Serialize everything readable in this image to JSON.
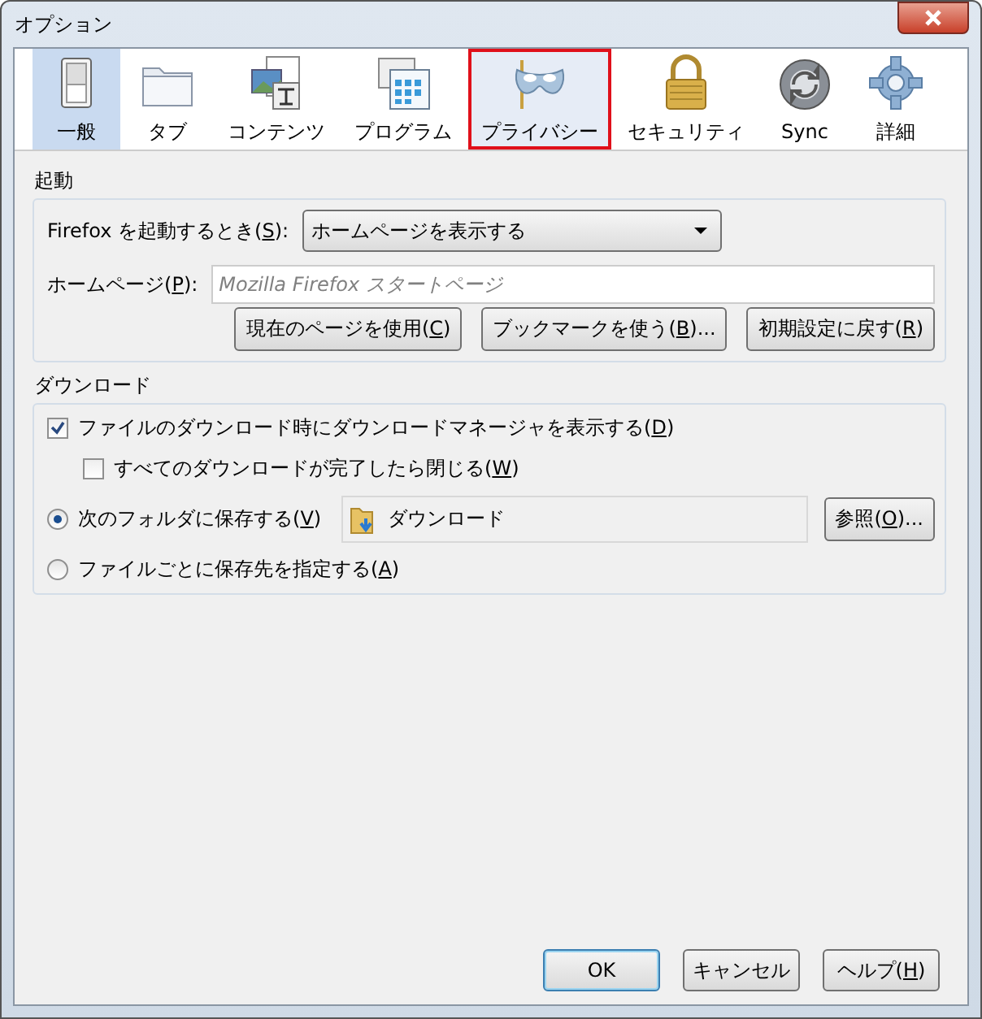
{
  "window": {
    "title": "オプション"
  },
  "tabs": [
    {
      "label": "一般",
      "selected": true,
      "highlighted": false
    },
    {
      "label": "タブ",
      "selected": false,
      "highlighted": false
    },
    {
      "label": "コンテンツ",
      "selected": false,
      "highlighted": false
    },
    {
      "label": "プログラム",
      "selected": false,
      "highlighted": false
    },
    {
      "label": "プライバシー",
      "selected": false,
      "highlighted": true
    },
    {
      "label": "セキュリティ",
      "selected": false,
      "highlighted": false
    },
    {
      "label": "Sync",
      "selected": false,
      "highlighted": false
    },
    {
      "label": "詳細",
      "selected": false,
      "highlighted": false
    }
  ],
  "startup": {
    "title": "起動",
    "startup_label": "Firefox を起動するとき(S):",
    "startup_value": "ホームページを表示する",
    "homepage_label": "ホームページ(P):",
    "homepage_placeholder": "Mozilla Firefox スタートページ",
    "buttons": [
      "現在のページを使用(C)",
      "ブックマークを使う(B)...",
      "初期設定に戻す(R)"
    ]
  },
  "downloads": {
    "title": "ダウンロード",
    "checks": [
      {
        "label": "ファイルのダウンロード時にダウンロードマネージャを表示する(D)",
        "checked": true,
        "children": [
          {
            "label": "すべてのダウンロードが完了したら閉じる(W)",
            "checked": false
          }
        ]
      }
    ],
    "radios": [
      {
        "label": "次のフォルダに保存する(V)",
        "selected": true,
        "folder": "ダウンロード",
        "browse": "参照(O)..."
      },
      {
        "label": "ファイルごとに保存先を指定する(A)",
        "selected": false
      }
    ]
  },
  "buttons": [
    {
      "label": "OK",
      "default": true
    },
    {
      "label": "キャンセル",
      "default": false
    },
    {
      "label": "ヘルプ(H)",
      "default": false
    }
  ]
}
